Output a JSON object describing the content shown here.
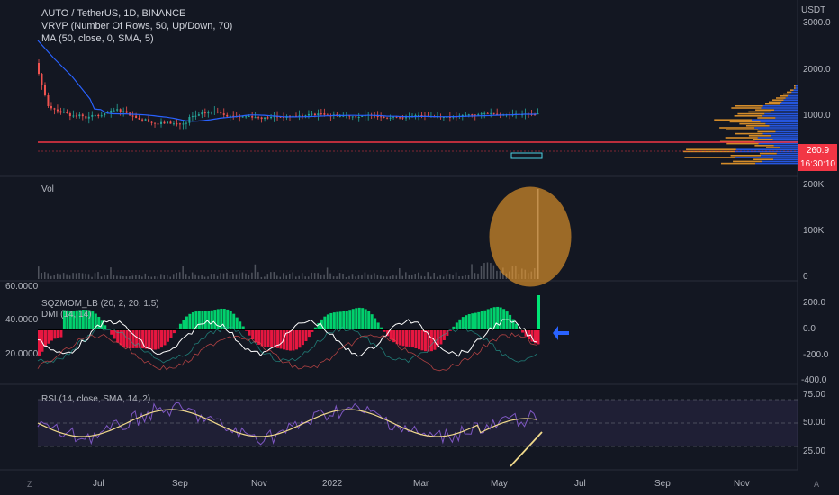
{
  "header": {
    "symbol_line": "AUTO / TetherUS, 1D, BINANCE",
    "vrvp_line": "VRVP (Number Of Rows, 50, Up/Down, 70)",
    "ma_line": "MA (50, close, 0, SMA, 5)"
  },
  "price_axis": {
    "currency": "USDT",
    "ticks": [
      "3000.0",
      "2000.0",
      "1000.0"
    ],
    "current_price": "260.9",
    "countdown": "16:30:10"
  },
  "volume_panel": {
    "label": "Vol",
    "ticks": [
      "200K",
      "100K",
      "0"
    ]
  },
  "squeeze_panel": {
    "label_sqz": "SQZMOM_LB (20, 2, 20, 1.5)",
    "label_dmi": "DMI (14, 14)",
    "left_ticks": [
      "60.0000",
      "40.0000",
      "20.0000"
    ],
    "right_ticks": [
      "200.0",
      "0.0",
      "-200.0",
      "-400.0"
    ]
  },
  "rsi_panel": {
    "label": "RSI (14, close, SMA, 14, 2)",
    "ticks": [
      "75.00",
      "50.00",
      "25.00"
    ]
  },
  "time_axis": {
    "ticks": [
      "Jul",
      "Sep",
      "Nov",
      "2022",
      "Mar",
      "May",
      "Jul",
      "Sep",
      "Nov"
    ]
  },
  "corners": {
    "left": "Z",
    "right": "A"
  },
  "colors": {
    "background": "#131722",
    "ma_line": "#2962ff",
    "horizontal_line": "#f23645",
    "up_candle": "#26a69a",
    "down_candle": "#ef5350",
    "volume_highlight": "#f7a12b",
    "sqz_up": "#00e676",
    "sqz_down": "#ff1744",
    "rsi_line": "#7e57c2",
    "rsi_ma": "#f0d98b",
    "arrow": "#2962ff"
  }
}
